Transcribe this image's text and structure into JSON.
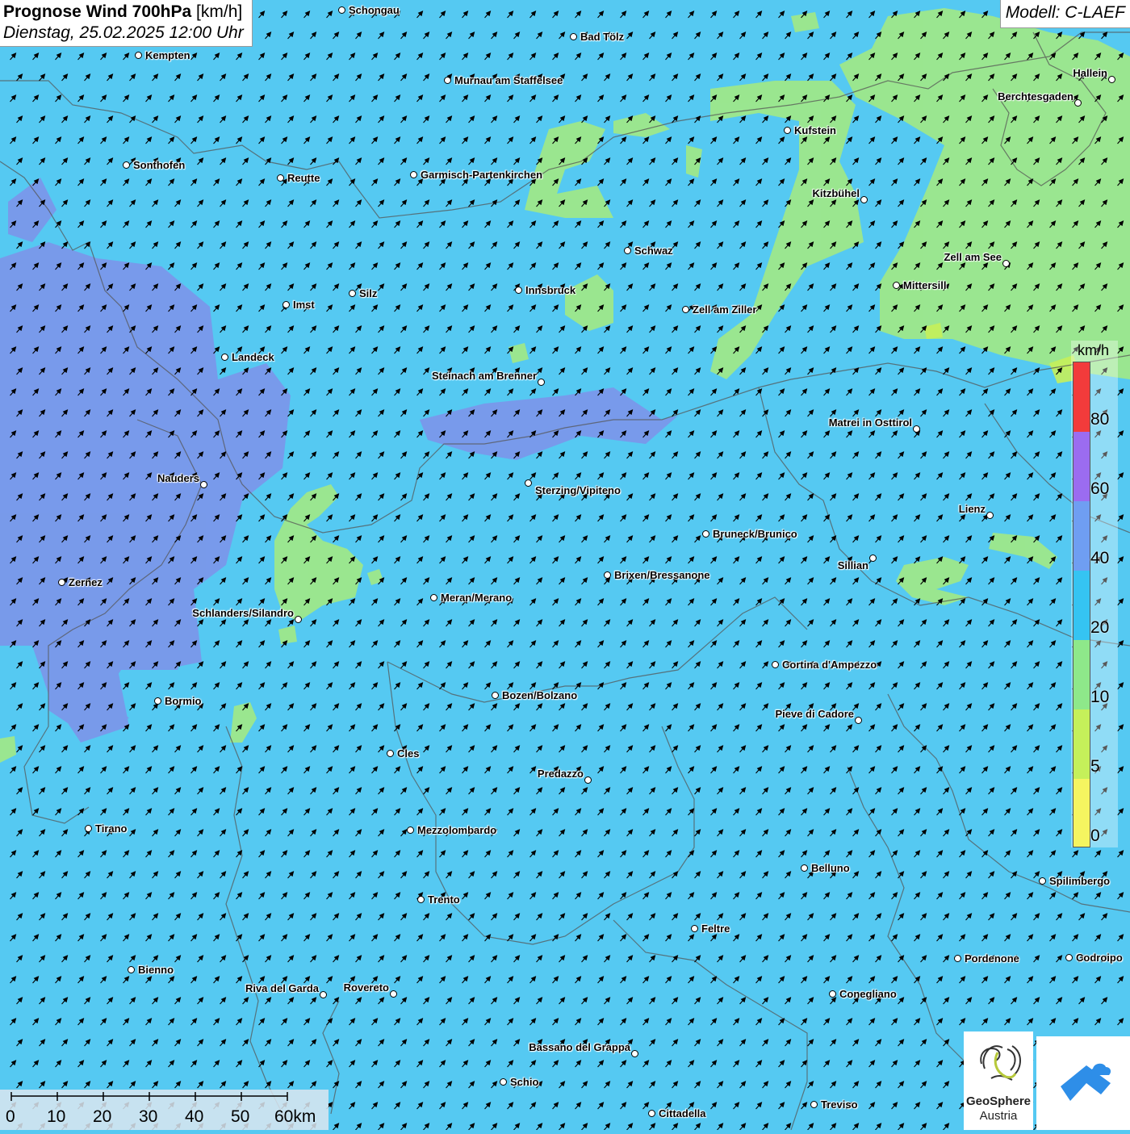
{
  "header": {
    "title_bold": "Prognose Wind 700hPa",
    "title_unit": "[km/h]",
    "subtitle": "Dienstag, 25.02.2025 12:00 Uhr",
    "model": "Modell: C-LAEF"
  },
  "legend": {
    "unit": "km/h",
    "labels": [
      "80",
      "60",
      "40",
      "20",
      "10",
      "5",
      "0"
    ],
    "colors": [
      "#f23b3b",
      "#9b6cf0",
      "#6f9ef2",
      "#35c4f2",
      "#8ee88a",
      "#c5f05a",
      "#f5f560"
    ]
  },
  "scalebar": {
    "labels": [
      "0",
      "10",
      "20",
      "30",
      "40",
      "50",
      "60km"
    ]
  },
  "logos": {
    "geosphere_line1": "GeoSphere",
    "geosphere_line2": "Austria"
  },
  "cities": [
    {
      "name": "Schongau"
    },
    {
      "name": "Bad Tölz"
    },
    {
      "name": "Kempten"
    },
    {
      "name": "Murnau am Staffelsee"
    },
    {
      "name": "Hallein"
    },
    {
      "name": "Berchtesgaden"
    },
    {
      "name": "Kufstein"
    },
    {
      "name": "Sonthofen"
    },
    {
      "name": "Reutte"
    },
    {
      "name": "Garmisch-Partenkirchen"
    },
    {
      "name": "Kitzbühel"
    },
    {
      "name": "Schwaz"
    },
    {
      "name": "Zell am See"
    },
    {
      "name": "Innsbruck"
    },
    {
      "name": "Mittersill"
    },
    {
      "name": "Silz"
    },
    {
      "name": "Imst"
    },
    {
      "name": "Zell am Ziller"
    },
    {
      "name": "Landeck"
    },
    {
      "name": "Steinach am Brenner"
    },
    {
      "name": "Matrei in Osttirol"
    },
    {
      "name": "Nauders"
    },
    {
      "name": "Sterzing/Vipiteno"
    },
    {
      "name": "Lienz"
    },
    {
      "name": "Bruneck/Brunico"
    },
    {
      "name": "Sillian"
    },
    {
      "name": "Brixen/Bressanone"
    },
    {
      "name": "Zernez"
    },
    {
      "name": "Meran/Merano"
    },
    {
      "name": "Schlanders/Silandro"
    },
    {
      "name": "Cortina d'Ampezzo"
    },
    {
      "name": "Bozen/Bolzano"
    },
    {
      "name": "Bormio"
    },
    {
      "name": "Pieve di Cadore"
    },
    {
      "name": "Cles"
    },
    {
      "name": "Predazzo"
    },
    {
      "name": "Tirano"
    },
    {
      "name": "Mezzolombardo"
    },
    {
      "name": "Belluno"
    },
    {
      "name": "Spilimbergo"
    },
    {
      "name": "Trento"
    },
    {
      "name": "Feltre"
    },
    {
      "name": "Pordenone"
    },
    {
      "name": "Codroipo"
    },
    {
      "name": "Bienno"
    },
    {
      "name": "Riva del Garda"
    },
    {
      "name": "Rovereto"
    },
    {
      "name": "Conegliano"
    },
    {
      "name": "Bassano del Grappa"
    },
    {
      "name": "Schio"
    },
    {
      "name": "Treviso"
    },
    {
      "name": "Cittadella"
    }
  ]
}
